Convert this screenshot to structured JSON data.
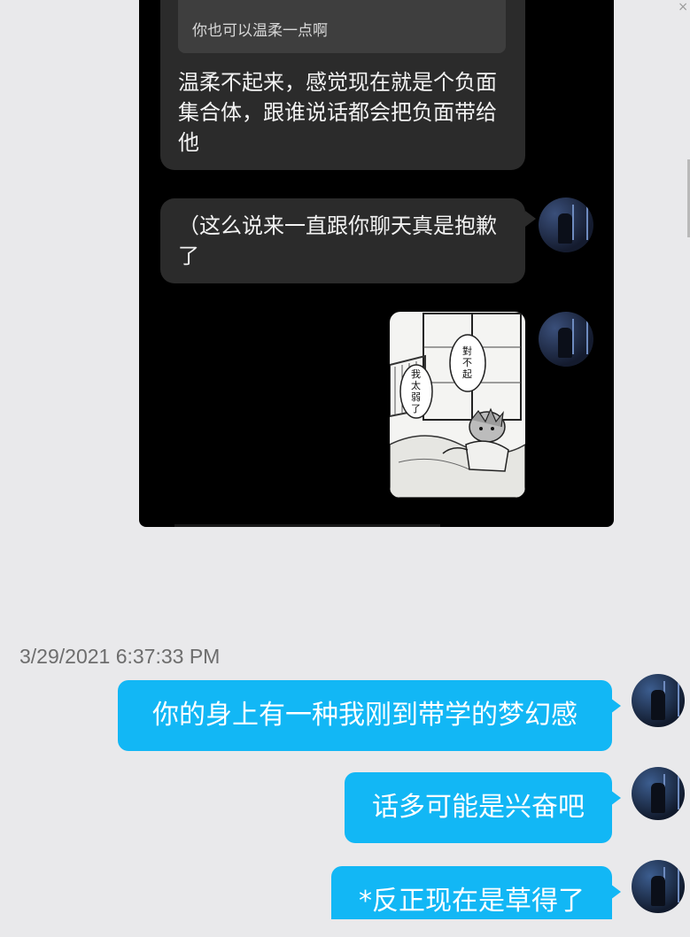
{
  "embedded_screenshot": {
    "quote_text": "你也可以温柔一点啊",
    "message_1": "温柔不起来，感觉现在就是个负面集合体，跟谁说话都会把负面带给他",
    "message_2": "（这么说来一直跟你聊天真是抱歉了",
    "sticker": {
      "bubble_1": "對不起",
      "bubble_2": "我太弱了"
    }
  },
  "chat": {
    "timestamp": "3/29/2021 6:37:33 PM",
    "messages": [
      {
        "text": "你的身上有一种我刚到带学的梦幻感"
      },
      {
        "text": "话多可能是兴奋吧"
      },
      {
        "text": "*反正现在是草得了"
      }
    ]
  },
  "colors": {
    "sent_bubble": "#12b7f5",
    "background": "#e9e9eb",
    "dark_bubble": "#2b2b2b"
  }
}
